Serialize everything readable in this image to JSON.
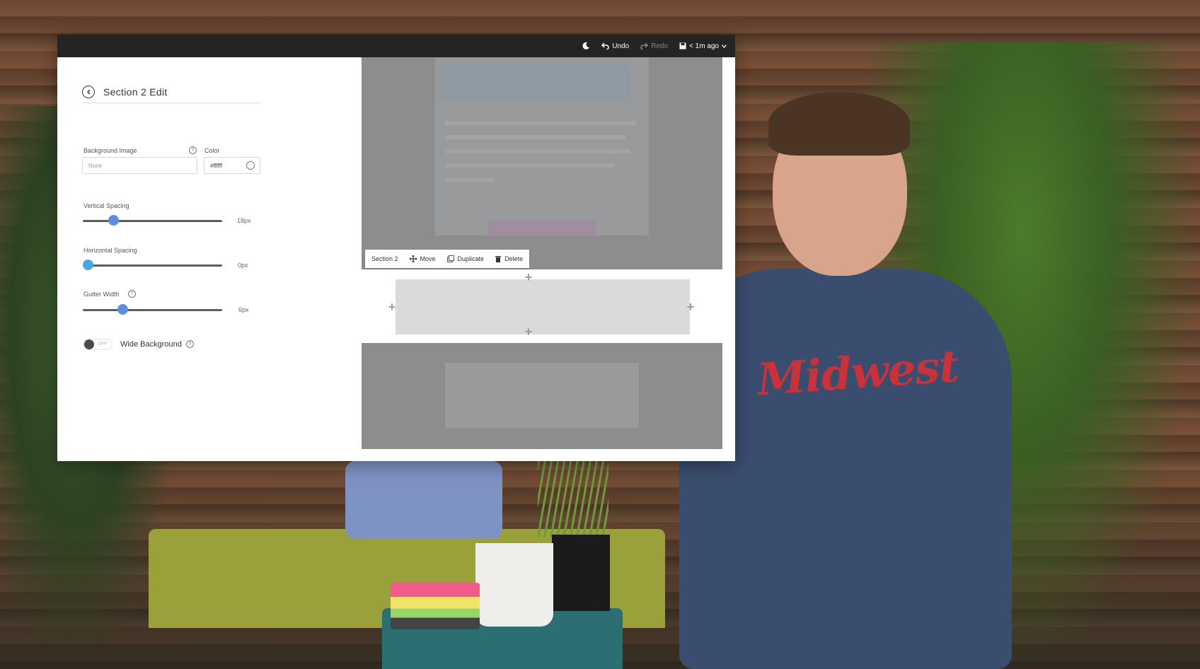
{
  "topbar": {
    "undo_label": "Undo",
    "redo_label": "Redo",
    "save_status": "< 1m ago"
  },
  "panel": {
    "title": "Section 2 Edit",
    "background_image": {
      "label": "Background Image",
      "placeholder": "None"
    },
    "color": {
      "label": "Color",
      "value": "#ffffff"
    },
    "vertical_spacing": {
      "label": "Vertical Spacing",
      "value": "18px",
      "level": 0.2
    },
    "horizontal_spacing": {
      "label": "Horizontal Spacing",
      "value": "0px",
      "level": 0.0
    },
    "gutter_width": {
      "label": "Gutter Width",
      "value": "6px",
      "level": 0.27
    },
    "wide_background": {
      "label": "Wide Background",
      "state": "OFF"
    }
  },
  "canvas": {
    "toolbar": {
      "section_label": "Section 2",
      "move_label": "Move",
      "duplicate_label": "Duplicate",
      "delete_label": "Delete"
    }
  },
  "scene": {
    "shirt_text": "Midwest"
  },
  "colors": {
    "slider_accent": "#5b8de0",
    "slider_accent_light": "#4aa6e6",
    "topbar_bg": "#242424"
  }
}
